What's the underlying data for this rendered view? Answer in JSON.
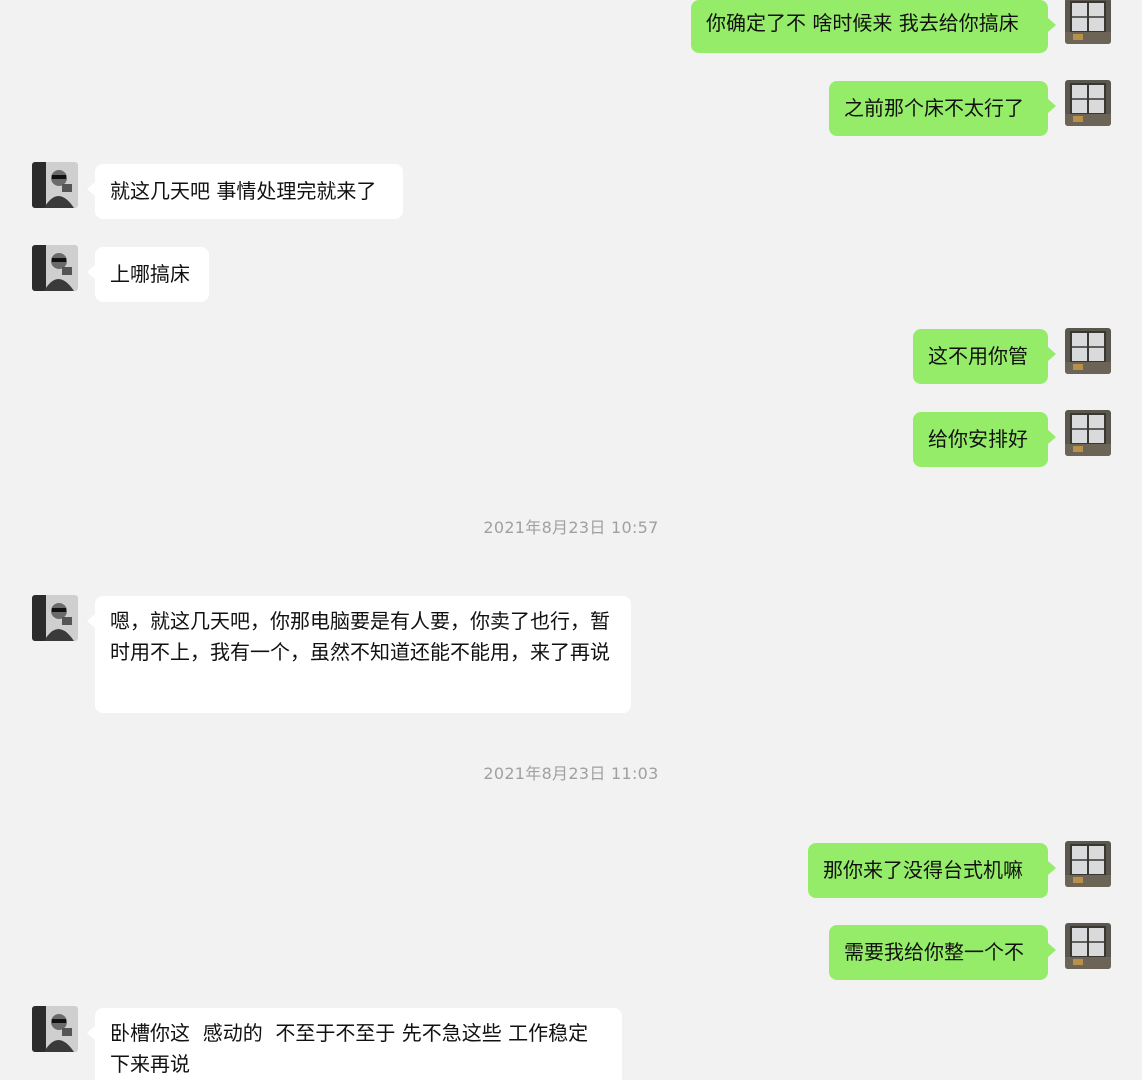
{
  "chat": {
    "messages": [
      {
        "side": "out",
        "text": "你确定了不 啥时候来 我去给你搞床"
      },
      {
        "side": "out",
        "text": "之前那个床不太行了"
      },
      {
        "side": "in",
        "text": "就这几天吧 事情处理完就来了"
      },
      {
        "side": "in",
        "text": "上哪搞床"
      },
      {
        "side": "out",
        "text": "这不用你管"
      },
      {
        "side": "out",
        "text": "给你安排好"
      },
      {
        "side": "in",
        "text": "嗯，就这几天吧，你那电脑要是有人要，你卖了也行，暂时用不上，我有一个，虽然不知道还能不能用，来了再说"
      },
      {
        "side": "out",
        "text": "那你来了没得台式机嘛"
      },
      {
        "side": "out",
        "text": "需要我给你整一个不"
      },
      {
        "side": "in",
        "text": "卧槽你这  感动的  不至于不至于 先不急这些 工作稳定下来再说"
      }
    ],
    "timestamps": [
      {
        "text": "2021年8月23日 10:57"
      },
      {
        "text": "2021年8月23日 11:03"
      }
    ]
  },
  "colors": {
    "background": "#f2f2f2",
    "outgoing_bubble": "#95ec69",
    "incoming_bubble": "#ffffff",
    "timestamp": "#a0a0a0"
  },
  "icons": {
    "self_avatar": "room-window-avatar",
    "contact_avatar": "bw-person-avatar"
  }
}
